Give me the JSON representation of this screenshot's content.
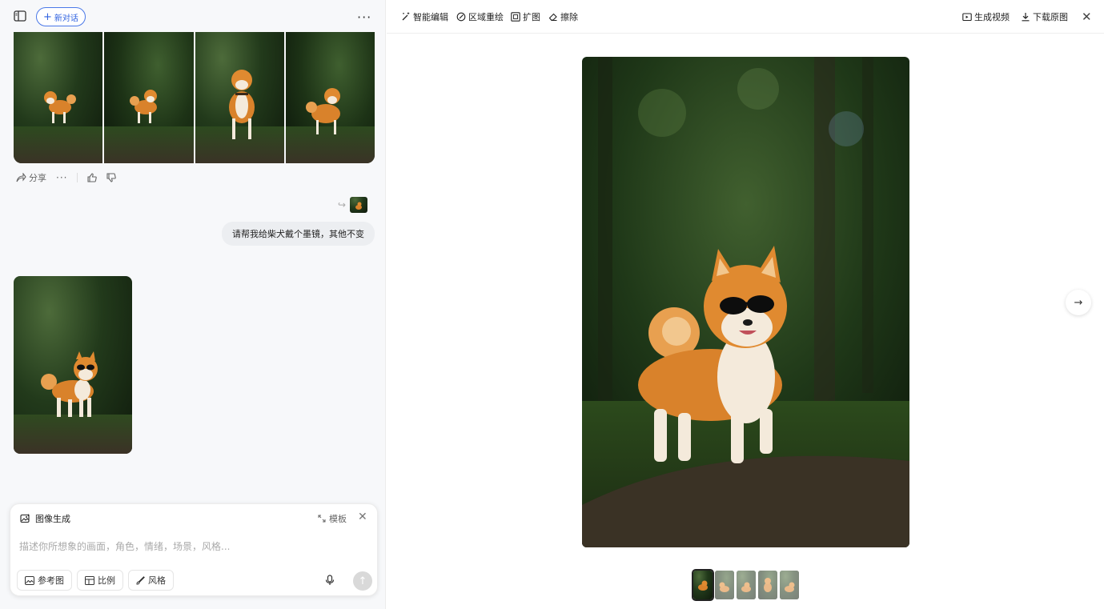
{
  "left": {
    "new_chat_label": "新对话",
    "actions": {
      "share_label": "分享"
    },
    "user_message": "请帮我给柴犬戴个墨镜，其他不变",
    "composer": {
      "mode_label": "图像生成",
      "template_label": "模板",
      "placeholder": "描述你所想象的画面，角色，情绪，场景，风格...",
      "chips": {
        "reference": "参考图",
        "ratio": "比例",
        "style": "风格"
      }
    }
  },
  "right": {
    "toolbar": {
      "smart_edit": "智能编辑",
      "region_redraw": "区域重绘",
      "expand": "扩图",
      "erase": "擦除",
      "generate_video": "生成视频",
      "download": "下载原图"
    }
  }
}
